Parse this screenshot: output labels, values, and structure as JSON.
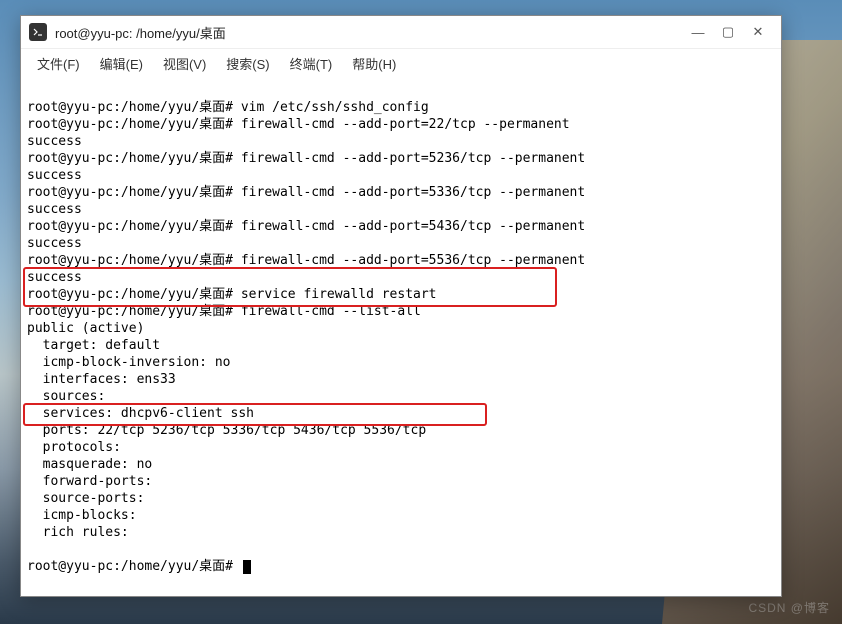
{
  "window": {
    "title": "root@yyu-pc: /home/yyu/桌面"
  },
  "menu": {
    "file": "文件(F)",
    "edit": "编辑(E)",
    "view": "视图(V)",
    "search": "搜索(S)",
    "terminal": "终端(T)",
    "help": "帮助(H)"
  },
  "terminal": {
    "prompt": "root@yyu-pc:/home/yyu/桌面#",
    "lines": [
      "root@yyu-pc:/home/yyu/桌面# vim /etc/ssh/sshd_config",
      "root@yyu-pc:/home/yyu/桌面# firewall-cmd --add-port=22/tcp --permanent",
      "success",
      "root@yyu-pc:/home/yyu/桌面# firewall-cmd --add-port=5236/tcp --permanent",
      "success",
      "root@yyu-pc:/home/yyu/桌面# firewall-cmd --add-port=5336/tcp --permanent",
      "success",
      "root@yyu-pc:/home/yyu/桌面# firewall-cmd --add-port=5436/tcp --permanent",
      "success",
      "root@yyu-pc:/home/yyu/桌面# firewall-cmd --add-port=5536/tcp --permanent",
      "success",
      "root@yyu-pc:/home/yyu/桌面# service firewalld restart",
      "root@yyu-pc:/home/yyu/桌面# firewall-cmd --list-all",
      "public (active)",
      "  target: default",
      "  icmp-block-inversion: no",
      "  interfaces: ens33",
      "  sources:",
      "  services: dhcpv6-client ssh",
      "  ports: 22/tcp 5236/tcp 5336/tcp 5436/tcp 5536/tcp",
      "  protocols:",
      "  masquerade: no",
      "  forward-ports:",
      "  source-ports:",
      "  icmp-blocks:",
      "  rich rules:",
      "",
      "root@yyu-pc:/home/yyu/桌面# "
    ]
  },
  "watermark": "CSDN @博客"
}
